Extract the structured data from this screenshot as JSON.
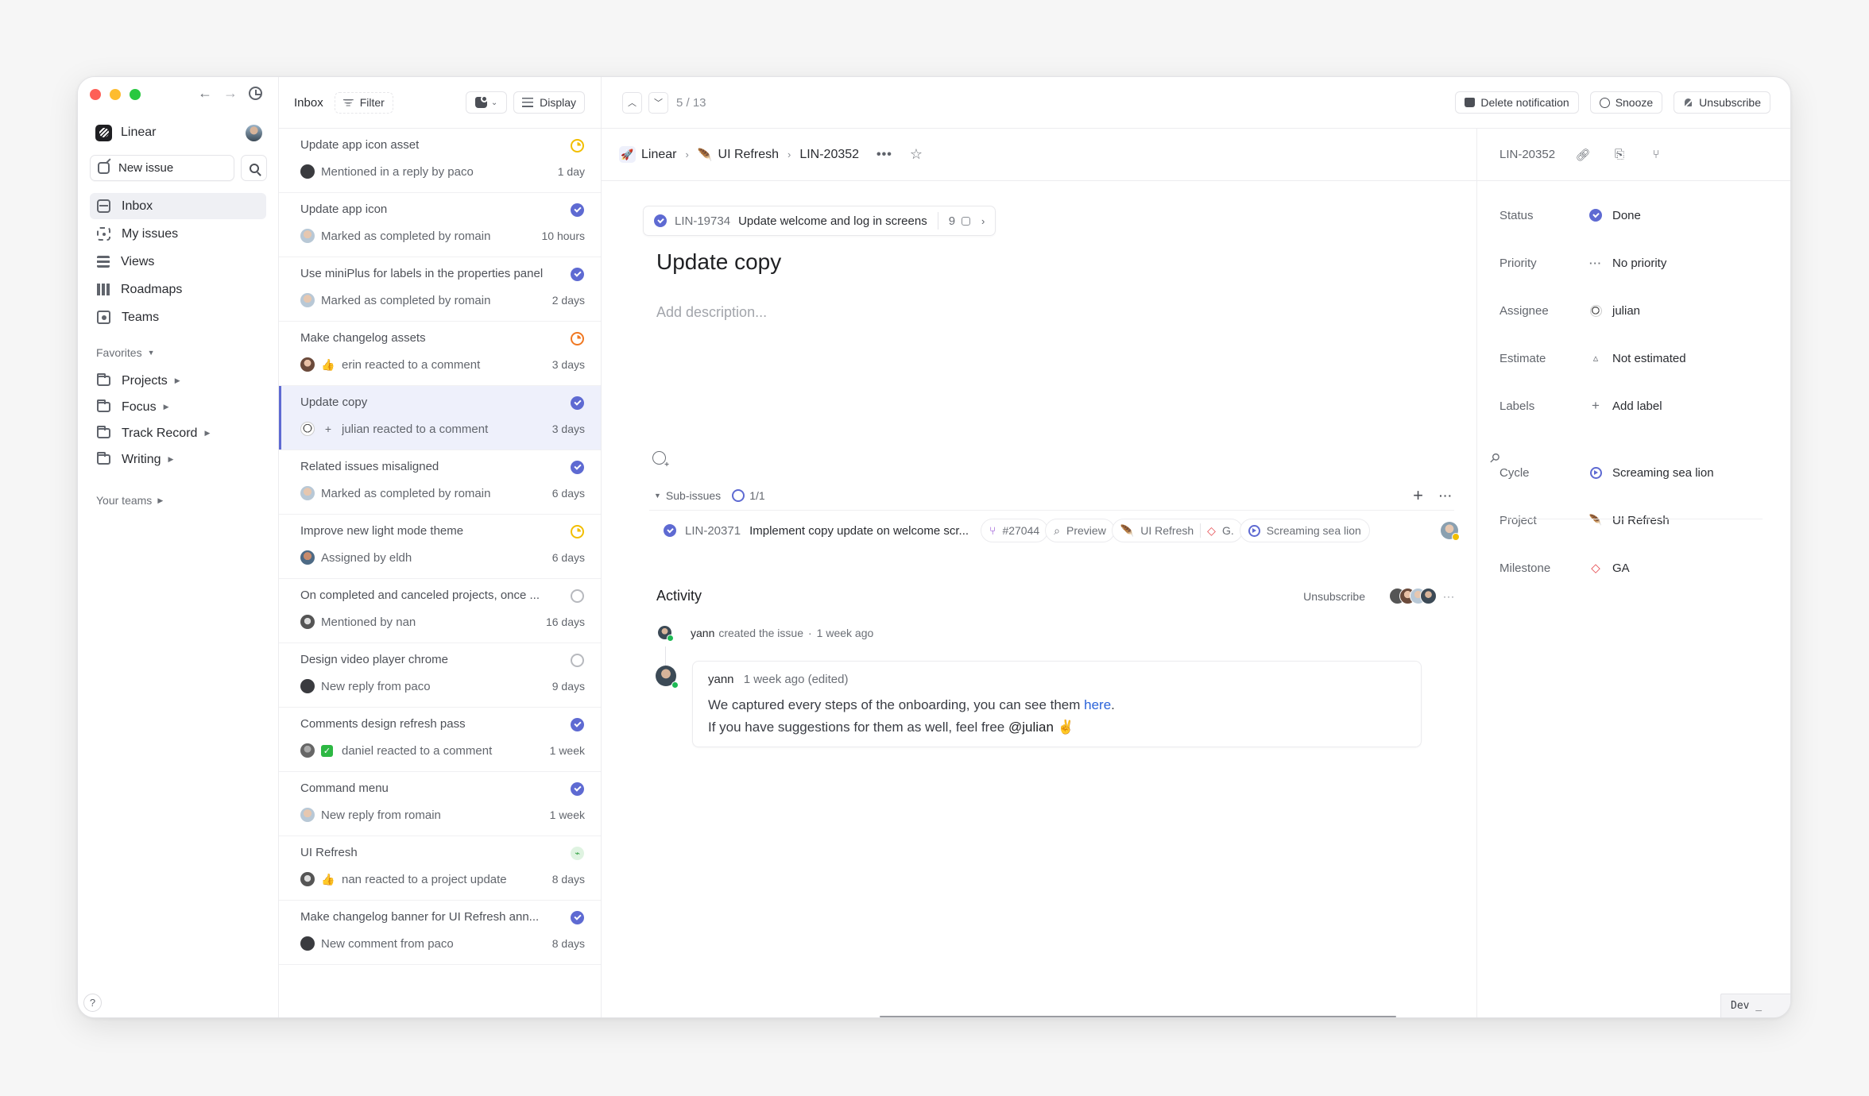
{
  "app": {
    "workspace": "Linear",
    "help_label": "?",
    "dev_badge": "Dev _"
  },
  "sidebar": {
    "new_issue_label": "New issue",
    "nav": [
      {
        "label": "Inbox",
        "icon": "inbox-icon",
        "active": true
      },
      {
        "label": "My issues",
        "icon": "my-issues-icon",
        "active": false
      },
      {
        "label": "Views",
        "icon": "views-icon",
        "active": false
      },
      {
        "label": "Roadmaps",
        "icon": "roadmaps-icon",
        "active": false
      },
      {
        "label": "Teams",
        "icon": "teams-icon",
        "active": false
      }
    ],
    "favorites_label": "Favorites",
    "favorites": [
      {
        "label": "Projects"
      },
      {
        "label": "Focus"
      },
      {
        "label": "Track Record"
      },
      {
        "label": "Writing"
      }
    ],
    "your_teams_label": "Your teams"
  },
  "inbox": {
    "title": "Inbox",
    "filter_label": "Filter",
    "display_label": "Display",
    "items": [
      {
        "title": "Update app icon asset",
        "status": "in-progress-yellow",
        "avatar": "paco",
        "emoji": "",
        "text": "Mentioned in a reply by paco",
        "time": "1 day",
        "selected": false
      },
      {
        "title": "Update app icon",
        "status": "done",
        "avatar": "romain",
        "emoji": "",
        "text": "Marked as completed by romain",
        "time": "10 hours",
        "selected": false
      },
      {
        "title": "Use miniPlus for labels in the properties panel",
        "status": "done",
        "avatar": "romain",
        "emoji": "",
        "text": "Marked as completed by romain",
        "time": "2 days",
        "selected": false
      },
      {
        "title": "Make changelog assets",
        "status": "in-progress-orange",
        "avatar": "erin",
        "emoji": "👍",
        "text": "erin reacted to a comment",
        "time": "3 days",
        "selected": false
      },
      {
        "title": "Update copy",
        "status": "done",
        "avatar": "julian",
        "emoji": "+",
        "text": "julian reacted to a comment",
        "time": "3 days",
        "selected": true
      },
      {
        "title": "Related issues misaligned",
        "status": "done",
        "avatar": "romain",
        "emoji": "",
        "text": "Marked as completed by romain",
        "time": "6 days",
        "selected": false
      },
      {
        "title": "Improve new light mode theme",
        "status": "in-progress-yellow",
        "avatar": "eldh",
        "emoji": "",
        "text": "Assigned by eldh",
        "time": "6 days",
        "selected": false
      },
      {
        "title": "On completed and canceled projects, once ...",
        "status": "todo",
        "avatar": "nan",
        "emoji": "",
        "text": "Mentioned by nan",
        "time": "16 days",
        "selected": false
      },
      {
        "title": "Design video player chrome",
        "status": "todo",
        "avatar": "paco",
        "emoji": "",
        "text": "New reply from paco",
        "time": "9 days",
        "selected": false
      },
      {
        "title": "Comments design refresh pass",
        "status": "done",
        "avatar": "daniel",
        "emoji": "✅",
        "text": "daniel reacted to a comment",
        "time": "1 week",
        "selected": false
      },
      {
        "title": "Command menu",
        "status": "done",
        "avatar": "romain",
        "emoji": "",
        "text": "New reply from romain",
        "time": "1 week",
        "selected": false
      },
      {
        "title": "UI Refresh",
        "status": "project-update",
        "avatar": "nan",
        "emoji": "👍",
        "text": "nan reacted to a project update",
        "time": "8 days",
        "selected": false
      },
      {
        "title": "Make changelog banner for UI Refresh ann...",
        "status": "done",
        "avatar": "paco",
        "emoji": "",
        "text": "New comment from paco",
        "time": "8 days",
        "selected": false
      }
    ]
  },
  "topbar": {
    "pager": "5 / 13",
    "actions": [
      {
        "label": "Delete notification",
        "icon": "delete-notification-icon"
      },
      {
        "label": "Snooze",
        "icon": "clock-icon"
      },
      {
        "label": "Unsubscribe",
        "icon": "bell-off-icon"
      }
    ]
  },
  "breadcrumb": {
    "team": "Linear",
    "project": "UI Refresh",
    "issue_id": "LIN-20352",
    "sep": "›",
    "more": "•••",
    "star": "☆"
  },
  "issue": {
    "parent": {
      "id": "LIN-19734",
      "title": "Update welcome and log in screens",
      "count": "9"
    },
    "title": "Update copy",
    "description_placeholder": "Add description...",
    "subissues": {
      "label": "Sub-issues",
      "progress": "1/1",
      "progress_fraction": 1.0,
      "items": [
        {
          "id": "LIN-20371",
          "title": "Implement copy update on welcome scr...",
          "pr": "#27044",
          "preview": "Preview",
          "project": "UI Refresh",
          "milestone": "G.",
          "cycle": "Screaming sea lion"
        }
      ]
    }
  },
  "activity": {
    "title": "Activity",
    "unsubscribe_label": "Unsubscribe",
    "event": {
      "user": "yann",
      "text": "created the issue",
      "sep": "·",
      "time": "1 week ago"
    },
    "comment": {
      "user": "yann",
      "time": "1 week ago (edited)",
      "line1_before": "We captured every steps of the onboarding, you can see them ",
      "line1_link": "here",
      "line1_after": ".",
      "line2_before": "If you have suggestions for them as well, feel free ",
      "line2_mention": "@julian",
      "line2_emoji": "✌️"
    }
  },
  "properties": {
    "issue_id": "LIN-20352",
    "rows": [
      {
        "label": "Status",
        "value": "Done",
        "icon": "done-icon"
      },
      {
        "label": "Priority",
        "value": "No priority",
        "icon": "no-priority-icon"
      },
      {
        "label": "Assignee",
        "value": "julian",
        "icon": "avatar"
      },
      {
        "label": "Estimate",
        "value": "Not estimated",
        "icon": "estimate-icon"
      },
      {
        "label": "Labels",
        "value": "Add label",
        "icon": "plus-icon"
      },
      {
        "label": "Cycle",
        "value": "Screaming sea lion",
        "icon": "cycle-icon"
      },
      {
        "label": "Project",
        "value": "UI Refresh",
        "icon": "feather-icon"
      },
      {
        "label": "Milestone",
        "value": "GA",
        "icon": "milestone-icon"
      }
    ]
  },
  "colors": {
    "accent": "#5e6ad2",
    "in_progress_yellow": "#f2be00",
    "in_progress_orange": "#f07822",
    "link": "#2b63d9",
    "milestone": "#e5484d",
    "online": "#1db954"
  }
}
